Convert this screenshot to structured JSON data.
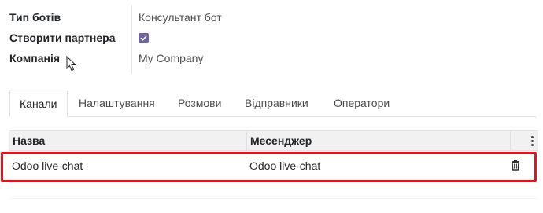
{
  "form": {
    "fields": [
      {
        "label": "Тип ботів",
        "value": "Консультант бот"
      },
      {
        "label": "Створити партнера",
        "checked": true
      },
      {
        "label": "Компанія",
        "value": "My Company"
      }
    ]
  },
  "tabs": [
    {
      "label": "Канали",
      "active": true
    },
    {
      "label": "Налаштування",
      "active": false
    },
    {
      "label": "Розмови",
      "active": false
    },
    {
      "label": "Відправники",
      "active": false
    },
    {
      "label": "Оператори",
      "active": false
    }
  ],
  "table": {
    "columns": [
      "Назва",
      "Месенджер"
    ],
    "rows": [
      {
        "name": "Odoo live-chat",
        "messenger": "Odoo live-chat"
      }
    ]
  },
  "colors": {
    "checkbox": "#71639e",
    "highlight": "#e0141e",
    "header_bg": "#f1f1f1"
  },
  "icons": [
    "check-icon",
    "mouse-pointer-icon",
    "kebab-menu-icon",
    "trash-icon"
  ]
}
